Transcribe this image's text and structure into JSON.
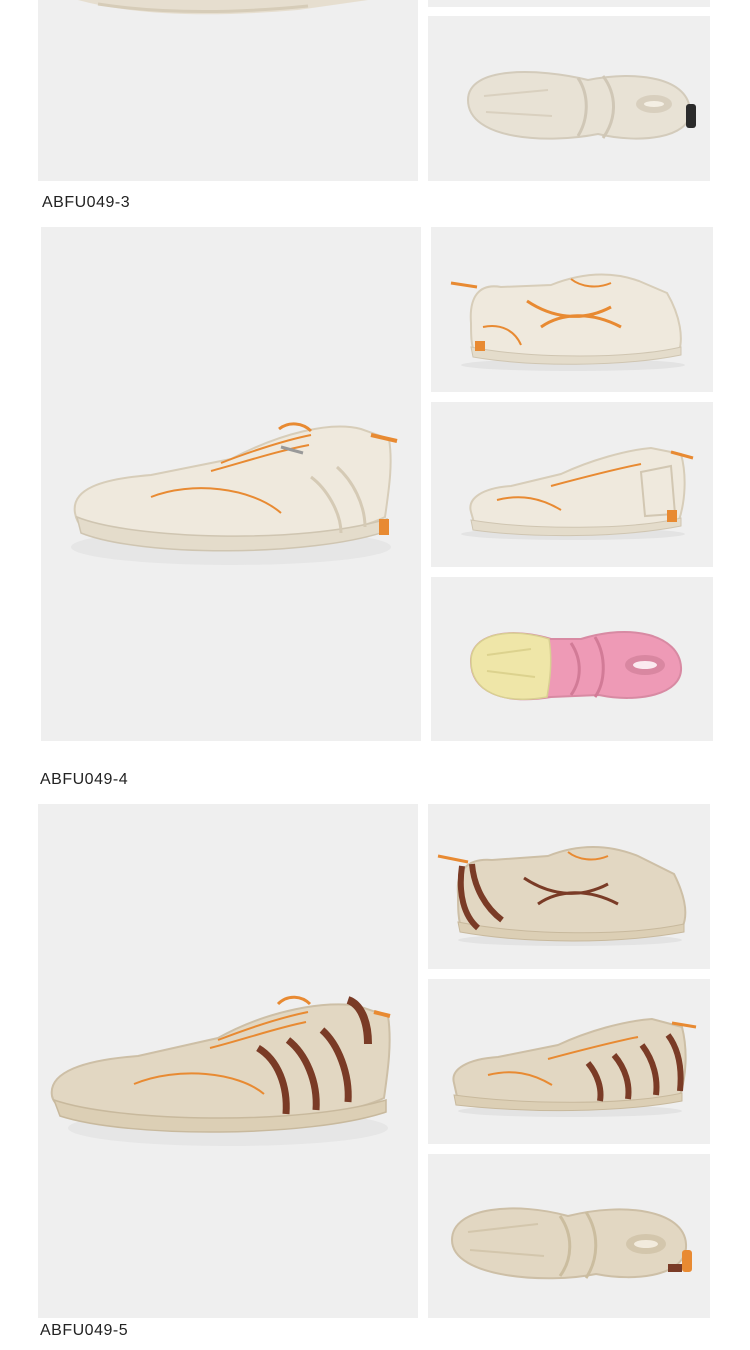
{
  "captions": {
    "c1": "ABFU049-3",
    "c2": "ABFU049-4",
    "c3": "ABFU049-5"
  },
  "colors": {
    "panel_bg": "#efefef",
    "shoe_cream": "#efe9dd",
    "sole_cream": "#e4dccb",
    "accent_orange": "#e88a32",
    "accent_brown": "#7a3b26",
    "outsole_pink": "#ee9ab6",
    "outsole_yellow": "#efe6a8",
    "shoe_tan": "#e2d7c2"
  },
  "icons": {
    "shoe_side": "shoe-side-icon",
    "shoe_angle": "shoe-angle-icon",
    "shoe_sole": "shoe-sole-icon"
  }
}
